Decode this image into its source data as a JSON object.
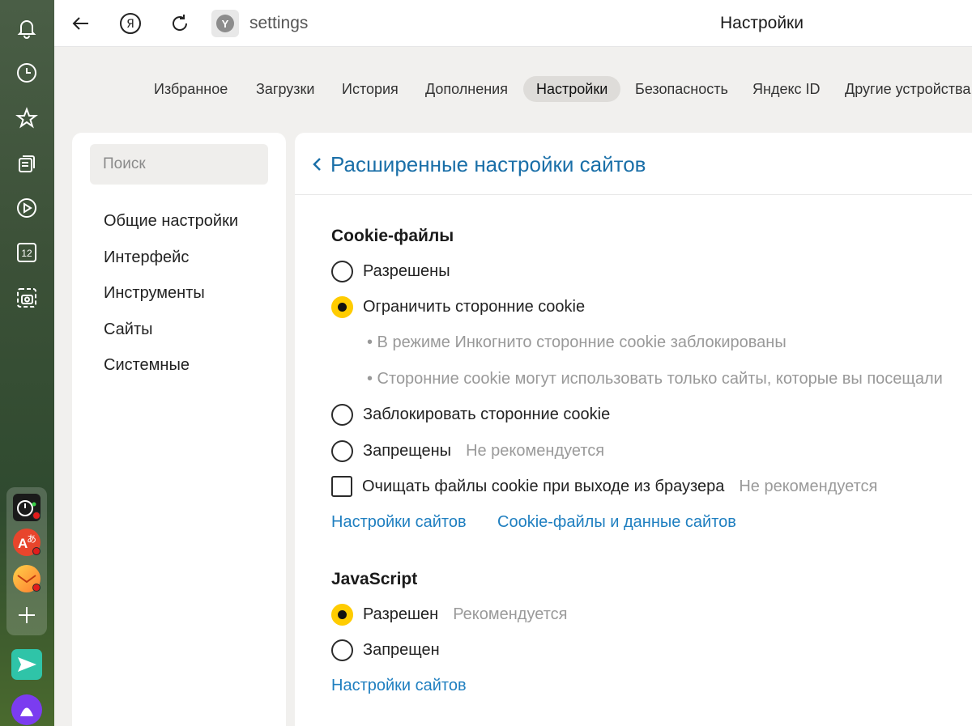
{
  "sidebar": {
    "icons": [
      "bell-icon",
      "clock-icon",
      "star-icon",
      "collections-icon",
      "video-play-icon",
      "calendar-12-icon",
      "screenshot-camera-icon"
    ],
    "calendar_day": "12",
    "extensions": [
      "timer-extension",
      "translator-extension",
      "mail-extension"
    ],
    "add_label": "+"
  },
  "topbar": {
    "url": "settings",
    "page_title": "Настройки",
    "ya_letter": "Я",
    "favicon_letter": "Y"
  },
  "tabs": [
    {
      "label": "Избранное"
    },
    {
      "label": "Загрузки"
    },
    {
      "label": "История"
    },
    {
      "label": "Дополнения"
    },
    {
      "label": "Настройки",
      "active": true
    },
    {
      "label": "Безопасность"
    },
    {
      "label": "Яндекс ID"
    },
    {
      "label": "Другие устройства"
    }
  ],
  "menu": {
    "search_placeholder": "Поиск",
    "items": [
      "Общие настройки",
      "Интерфейс",
      "Инструменты",
      "Сайты",
      "Системные"
    ]
  },
  "main": {
    "title": "Расширенные настройки сайтов",
    "cookies": {
      "title": "Cookie-файлы",
      "options": [
        {
          "label": "Разрешены",
          "checked": false
        },
        {
          "label": "Ограничить сторонние cookie",
          "checked": true
        },
        {
          "label": "Заблокировать сторонние cookie",
          "checked": false
        },
        {
          "label": "Запрещены",
          "note": "Не рекомендуется",
          "checked": false
        }
      ],
      "sub_notes": [
        "• В режиме Инкогнито сторонние cookie заблокированы",
        "• Сторонние cookie могут использовать только сайты, которые вы посещали"
      ],
      "clear_checkbox": {
        "label": "Очищать файлы cookie при выходе из браузера",
        "note": "Не рекомендуется",
        "checked": false
      },
      "link_sites": "Настройки сайтов",
      "link_data": "Cookie-файлы и данные сайтов"
    },
    "javascript": {
      "title": "JavaScript",
      "options": [
        {
          "label": "Разрешен",
          "note": "Рекомендуется",
          "checked": true
        },
        {
          "label": "Запрещен",
          "checked": false
        }
      ],
      "link_sites": "Настройки сайтов"
    }
  },
  "colors": {
    "accent_yellow": "#ffcc00",
    "link_blue": "#1f7fc0",
    "title_blue": "#1a6fa8"
  }
}
